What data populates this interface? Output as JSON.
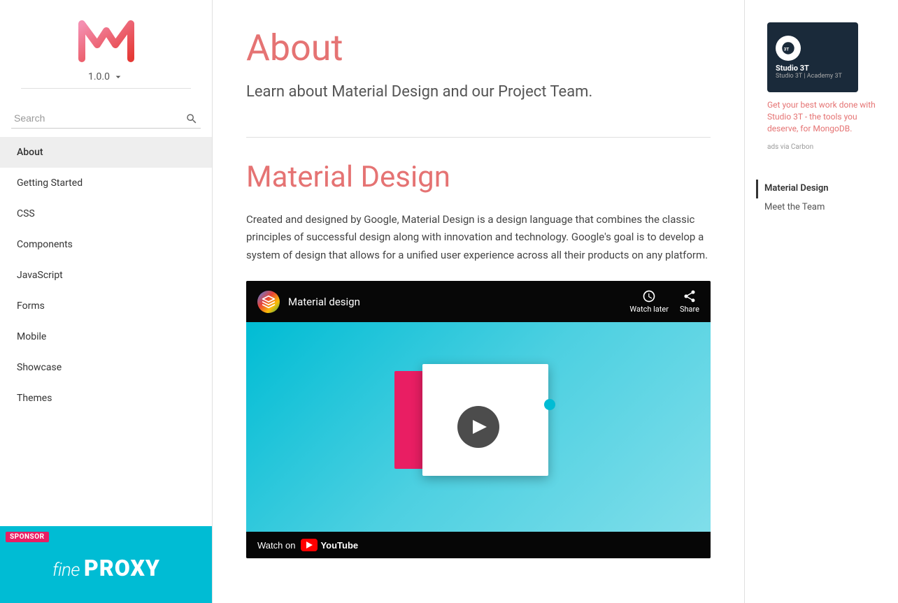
{
  "sidebar": {
    "version": "1.0.0",
    "search_placeholder": "Search",
    "nav_items": [
      {
        "id": "about",
        "label": "About",
        "active": true
      },
      {
        "id": "getting-started",
        "label": "Getting Started",
        "active": false
      },
      {
        "id": "css",
        "label": "CSS",
        "active": false
      },
      {
        "id": "components",
        "label": "Components",
        "active": false
      },
      {
        "id": "javascript",
        "label": "JavaScript",
        "active": false
      },
      {
        "id": "forms",
        "label": "Forms",
        "active": false
      },
      {
        "id": "mobile",
        "label": "Mobile",
        "active": false
      },
      {
        "id": "showcase",
        "label": "Showcase",
        "active": false
      },
      {
        "id": "themes",
        "label": "Themes",
        "active": false
      }
    ],
    "sponsor": {
      "badge": "SPONSOR",
      "fine": "fine",
      "proxy": "PROXY"
    }
  },
  "main": {
    "page_title": "About",
    "page_subtitle": "Learn about Material Design and our Project Team.",
    "section_title": "Material Design",
    "section_body": "Created and designed by Google, Material Design is a design language that combines the classic principles of successful design along with innovation and technology. Google's goal is to develop a system of design that allows for a unified user experience across all their products on any platform.",
    "video": {
      "title": "Material design",
      "watch_later": "Watch later",
      "share": "Share",
      "watch_on": "Watch on"
    }
  },
  "toc": {
    "items": [
      {
        "label": "Material Design",
        "active": true
      },
      {
        "label": "Meet the Team",
        "active": false
      }
    ]
  },
  "ad": {
    "logo_text": "Studio 3T",
    "logo_sub": "Studio 3T | Academy 3T",
    "description": "Get your best work done with Studio 3T - the tools you deserve, for MongoDB.",
    "source": "ads via Carbon"
  }
}
